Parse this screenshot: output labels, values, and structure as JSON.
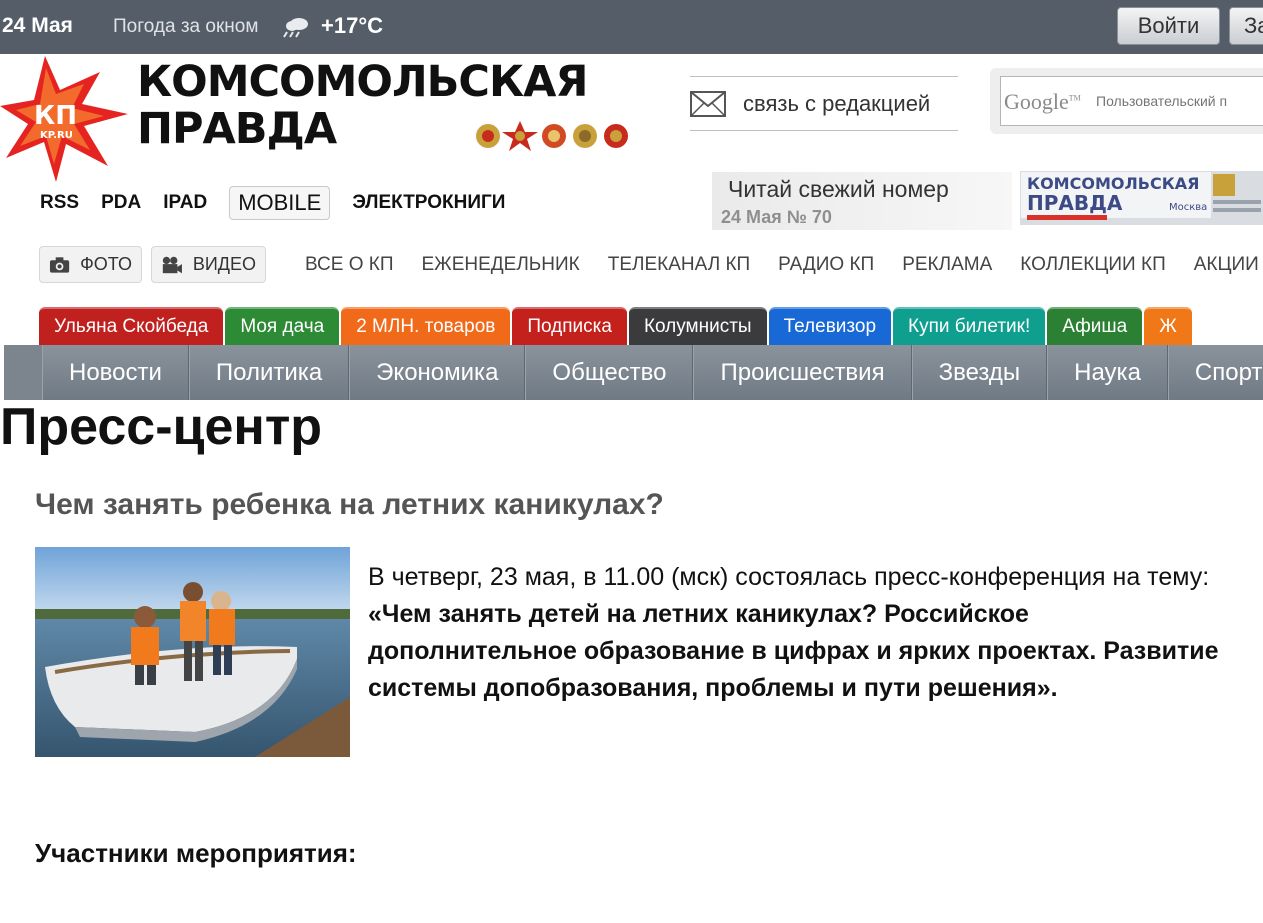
{
  "topbar": {
    "date": "24 Мая",
    "weather_label": "Погода за окном",
    "temperature": "+17°C",
    "login_label": "Войти",
    "register_label": "За"
  },
  "logo": {
    "badge_top": "КП",
    "badge_bottom": "KP.RU",
    "line1": "КОМСОМОЛЬСКАЯ",
    "line2": "ПРАВДА"
  },
  "contact": {
    "label": "связь с редакцией"
  },
  "search": {
    "google": "Google",
    "tm": "TM",
    "placeholder": "Пользовательский п"
  },
  "links": [
    {
      "label": "RSS"
    },
    {
      "label": "PDA"
    },
    {
      "label": "IPAD"
    },
    {
      "label": "MOBILE"
    },
    {
      "label": "ЭЛЕКТРОКНИГИ"
    }
  ],
  "issue": {
    "title": "Читай свежий номер",
    "subtitle": "24 Мая № 70",
    "paper_line1": "КОМСОМОЛЬСКАЯ",
    "paper_line2": "ПРАВДА",
    "paper_city": "Москва"
  },
  "media": {
    "foto_label": "ФОТО",
    "video_label": "ВИДЕО"
  },
  "topnav": [
    {
      "label": "ВСЕ О КП"
    },
    {
      "label": "ЕЖЕНЕДЕЛЬНИК"
    },
    {
      "label": "ТЕЛЕКАНАЛ КП"
    },
    {
      "label": "РАДИО КП"
    },
    {
      "label": "РЕКЛАМА"
    },
    {
      "label": "КОЛЛЕКЦИИ КП"
    },
    {
      "label": "АКЦИИ"
    }
  ],
  "tabs": [
    {
      "label": "Ульяна Скойбеда",
      "color": "#c0201e"
    },
    {
      "label": "Моя дача",
      "color": "#2d8a35"
    },
    {
      "label": "2 МЛН. товаров",
      "color": "#f06a1a"
    },
    {
      "label": "Подписка",
      "color": "#c4201c"
    },
    {
      "label": "Колумнисты",
      "color": "#3b3b3d"
    },
    {
      "label": "Телевизор",
      "color": "#1869d6"
    },
    {
      "label": "Купи билетик!",
      "color": "#0f9f8f"
    },
    {
      "label": "Афиша",
      "color": "#2c8033"
    },
    {
      "label": "Ж",
      "color": "#f07818"
    }
  ],
  "sections": [
    {
      "label": "Новости"
    },
    {
      "label": "Политика"
    },
    {
      "label": "Экономика"
    },
    {
      "label": "Общество"
    },
    {
      "label": "Происшествия"
    },
    {
      "label": "Звезды"
    },
    {
      "label": "Наука"
    },
    {
      "label": "Спорт"
    }
  ],
  "page": {
    "title": "Пресс-центр",
    "article_title": "Чем занять ребенка на летних каникулах?",
    "lead_plain": "В четверг, 23 мая, в 11.00 (мск) состоялась пресс-конференция на тему: ",
    "lead_bold": "«Чем занять детей на летних каникулах? Российское дополнительное образование  в цифрах и ярких проектах. Развитие системы допобразования, проблемы и пути решения».",
    "participants_heading": "Участники мероприятия:"
  }
}
